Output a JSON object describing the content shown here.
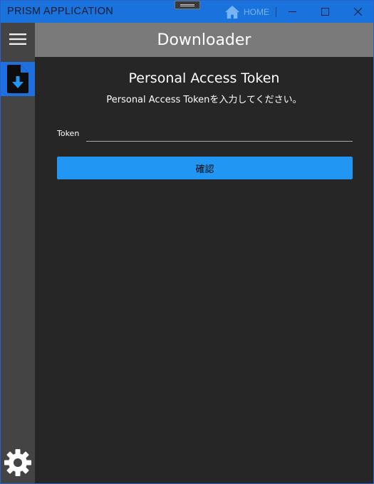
{
  "window": {
    "title": "PRISM APPLICATION",
    "home_label": "HOME"
  },
  "header": {
    "title": "Downloader"
  },
  "main": {
    "title": "Personal Access Token",
    "subtitle": "Personal Access Tokenを入力してください。",
    "token_label": "Token",
    "token_value": "",
    "token_placeholder": "",
    "confirm_label": "確認"
  },
  "colors": {
    "titlebar": "#1a73dc",
    "accent": "#2196f3",
    "nav_active": "#1e6fe0",
    "sidebar": "#444444",
    "header": "#7a7a7a",
    "background": "#262626"
  },
  "icons": {
    "home": "home-icon",
    "minimize": "minimize-icon",
    "maximize": "maximize-icon",
    "close": "close-icon",
    "menu": "hamburger-icon",
    "download": "file-download-icon",
    "settings": "gear-icon"
  }
}
